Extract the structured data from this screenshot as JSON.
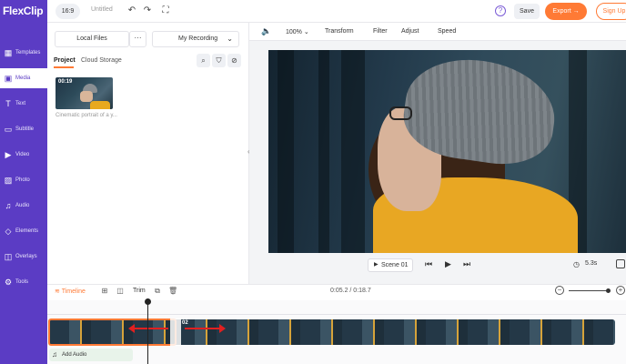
{
  "header": {
    "logo_text": "FlexClip",
    "aspect_ratio": "16:9",
    "project_title": "Untitled",
    "help_icon": "?",
    "save_label": "Save",
    "export_label": "Export →",
    "signup_label": "Sign Up",
    "brand_color": "#5b3cc4",
    "accent_color": "#ff7a35"
  },
  "sidebar": {
    "items": [
      {
        "label": "Templates",
        "icon": "templates-icon",
        "glyph": "▦"
      },
      {
        "label": "Media",
        "icon": "media-icon",
        "glyph": "▣"
      },
      {
        "label": "Text",
        "icon": "text-icon",
        "glyph": "T"
      },
      {
        "label": "Subtitle",
        "icon": "subtitle-icon",
        "glyph": "▭"
      },
      {
        "label": "Video",
        "icon": "video-icon",
        "glyph": "▶"
      },
      {
        "label": "Photo",
        "icon": "photo-icon",
        "glyph": "▨"
      },
      {
        "label": "Audio",
        "icon": "audio-icon",
        "glyph": "♫"
      },
      {
        "label": "Elements",
        "icon": "elements-icon",
        "glyph": "◇"
      },
      {
        "label": "Overlays",
        "icon": "overlays-icon",
        "glyph": "◫"
      },
      {
        "label": "Tools",
        "icon": "tools-icon",
        "glyph": "⚙"
      }
    ],
    "active": "Media"
  },
  "media_panel": {
    "local_files_label": "Local Files",
    "more_label": "···",
    "recording_label": "My Recording",
    "tabs": [
      "Project",
      "Cloud Storage"
    ],
    "active_tab": "Project",
    "thumb_duration": "00:19",
    "thumb_caption": "Cinematic portrait of a y..."
  },
  "preview_toolbar": {
    "volume_icon": "🔈",
    "zoom": "100%",
    "items": [
      "Transform",
      "Filter",
      "Adjust",
      "Speed"
    ]
  },
  "player": {
    "scene_label": "Scene 01",
    "duration": "5.3s"
  },
  "timeline": {
    "label": "Timeline",
    "trim_label": "Trim",
    "time_readout": "0:05.2 / 0:18.7",
    "clip2_badge": "02",
    "add_audio_label": "Add Audio"
  }
}
